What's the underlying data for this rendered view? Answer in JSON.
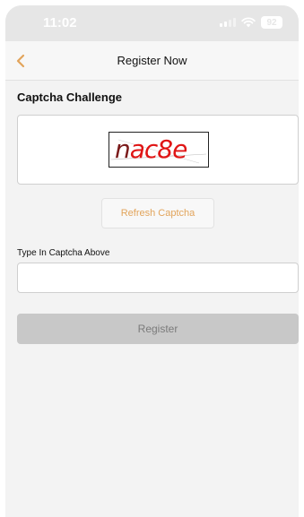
{
  "status_bar": {
    "time": "11:02",
    "battery": "92",
    "icons": [
      "signal-icon",
      "wifi-icon",
      "battery-icon"
    ]
  },
  "nav": {
    "title": "Register Now",
    "back_icon": "chevron-left-icon"
  },
  "captcha": {
    "section_title": "Captcha Challenge",
    "code_prefix": "n",
    "code_rest": "ac8e",
    "refresh_label": "Refresh Captcha"
  },
  "form": {
    "input_label": "Type In Captcha Above",
    "input_value": "",
    "input_placeholder": ""
  },
  "register": {
    "label": "Register"
  },
  "colors": {
    "accent": "#e2a45b",
    "status_bar": "#e6e6e6",
    "background": "#f3f3f3",
    "disabled_button": "#c8c8c8",
    "captcha_red": "#e01616"
  }
}
